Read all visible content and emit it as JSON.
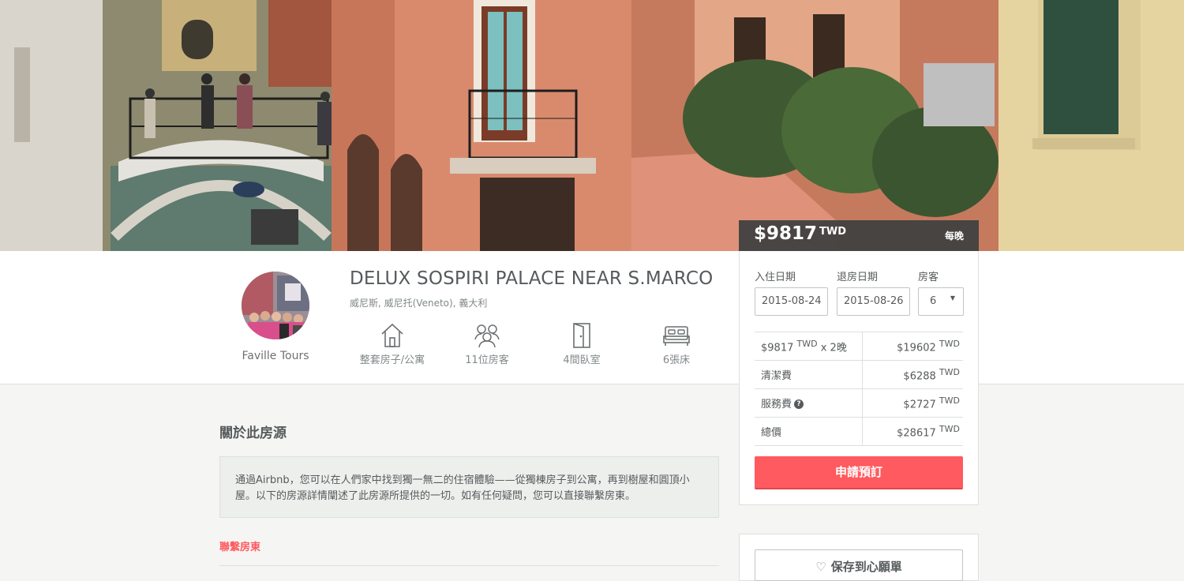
{
  "listing": {
    "title": "DELUX SOSPIRI PALACE NEAR S.MARCO",
    "location": "威尼斯, 威尼托(Veneto), 義大利",
    "host_name": "Faville Tours"
  },
  "amenities": [
    {
      "icon": "house-icon",
      "label": "整套房子/公寓"
    },
    {
      "icon": "guests-icon",
      "label": "11位房客"
    },
    {
      "icon": "door-icon",
      "label": "4間臥室"
    },
    {
      "icon": "bed-icon",
      "label": "6張床"
    }
  ],
  "price_header": {
    "amount": "$9817",
    "currency": "TWD",
    "per": "每晚"
  },
  "booking": {
    "checkin_label": "入住日期",
    "checkout_label": "退房日期",
    "guests_label": "房客",
    "checkin_value": "2015-08-24",
    "checkout_value": "2015-08-26",
    "guests_value": "6",
    "rows": [
      {
        "label": "$9817",
        "label_sup": "TWD",
        "label_suffix": "x 2晚",
        "value": "$19602",
        "value_sup": "TWD"
      },
      {
        "label": "清潔費",
        "value": "$6288",
        "value_sup": "TWD"
      },
      {
        "label": "服務費",
        "help_icon": "question-icon",
        "value": "$2727",
        "value_sup": "TWD"
      },
      {
        "label": "總價",
        "value": "$28617",
        "value_sup": "TWD"
      }
    ],
    "book_button": "申請預訂"
  },
  "about": {
    "heading": "關於此房源",
    "text": "通過Airbnb，您可以在人們家中找到獨一無二的住宿體驗——從獨棟房子到公寓，再到樹屋和圓頂小屋。以下的房源詳情闡述了此房源所提供的一切。如有任何疑問，您可以直接聯繫房東。",
    "contact_link": "聯繫房東"
  },
  "wishlist": {
    "button": "保存到心願單",
    "icon": "heart-icon"
  },
  "colors": {
    "accent": "#ff5a5f",
    "text": "#565a5c",
    "muted": "#82888a"
  }
}
